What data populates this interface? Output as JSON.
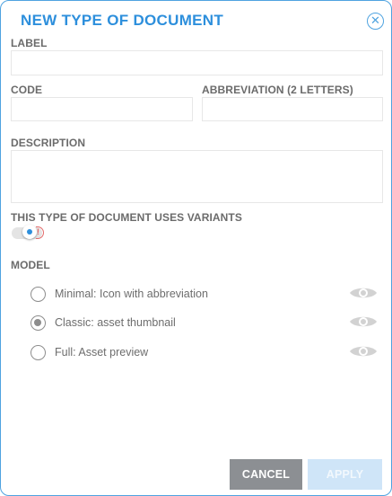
{
  "dialog": {
    "title": "NEW TYPE OF DOCUMENT",
    "close_icon": "close-icon"
  },
  "form": {
    "label": {
      "label": "LABEL",
      "value": ""
    },
    "code": {
      "label": "CODE",
      "value": ""
    },
    "abbreviation": {
      "label": "ABBREVIATION (2 LETTERS)",
      "value": ""
    },
    "description": {
      "label": "DESCRIPTION",
      "value": ""
    },
    "variants": {
      "label": "THIS TYPE OF DOCUMENT USES VARIANTS",
      "warning_glyph": "!",
      "enabled": true
    }
  },
  "model": {
    "label": "MODEL",
    "options": [
      {
        "label": "Minimal: Icon with abbreviation",
        "selected": false,
        "icon": "eye-icon"
      },
      {
        "label": "Classic: asset thumbnail",
        "selected": true,
        "icon": "eye-icon"
      },
      {
        "label": "Full: Asset preview",
        "selected": false,
        "icon": "eye-icon"
      }
    ]
  },
  "actions": {
    "cancel": "CANCEL",
    "apply": "APPLY"
  },
  "colors": {
    "accent": "#2d8fdc",
    "cancel_bg": "#8c8f93",
    "apply_disabled_bg": "#cfe5f8",
    "warning": "#e36b6b"
  }
}
